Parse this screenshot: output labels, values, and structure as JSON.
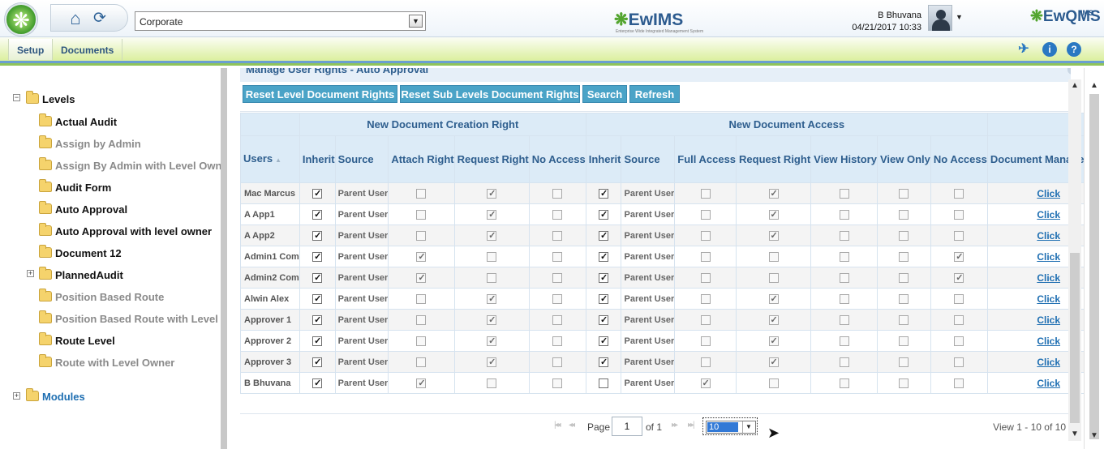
{
  "header": {
    "company": "Corporate",
    "center_logo": "EwIMS",
    "center_logo_tagline": "Enterprise Wide Integrated Management System",
    "user_name": "B Bhuvana",
    "datetime": "04/21/2017 10:33",
    "right_logo": "EwQMS",
    "right_logo_sup": "IMS",
    "home_icon": "home-icon",
    "refresh_icon": "refresh-icon"
  },
  "menu": {
    "setup": "Setup",
    "documents": "Documents",
    "icons": [
      "pin-icon",
      "info-icon",
      "help-icon"
    ]
  },
  "tree": {
    "levels_label": "Levels",
    "levels_expander": "−",
    "modules_label": "Modules",
    "modules_expander": "+",
    "children": [
      {
        "label": "Actual Audit",
        "style": "bold"
      },
      {
        "label": "Assign by Admin",
        "style": "grey"
      },
      {
        "label": "Assign By Admin with Level Owner",
        "style": "grey"
      },
      {
        "label": "Audit Form",
        "style": "bold"
      },
      {
        "label": "Auto Approval",
        "style": "bold"
      },
      {
        "label": "Auto Approval with level owner",
        "style": "bold"
      },
      {
        "label": "Document 12",
        "style": "bold"
      },
      {
        "label": "PlannedAudit",
        "style": "bold",
        "expander": "+"
      },
      {
        "label": "Position Based Route",
        "style": "grey"
      },
      {
        "label": "Position Based Route with Level Owner",
        "style": "grey"
      },
      {
        "label": "Route Level",
        "style": "bold"
      },
      {
        "label": "Route with Level Owner",
        "style": "grey"
      }
    ]
  },
  "section_title": "Manage User Rights - Auto Approval",
  "actions": {
    "reset_level": "Reset Level Document Rights",
    "reset_sub": "Reset Sub Levels Document Rights",
    "search": "Search",
    "refresh": "Refresh"
  },
  "grid": {
    "group_creation": "New Document Creation Right",
    "group_access": "New Document Access",
    "columns": {
      "users": "Users",
      "inherit": "Inherit",
      "source": "Source",
      "attach_right": "Attach Right",
      "request_right": "Request Right",
      "no_access": "No Access",
      "inherit2": "Inherit",
      "source2": "Source",
      "full_access": "Full Access",
      "request_right2": "Request Right",
      "view_history": "View History",
      "view_only": "View Only",
      "no_access2": "No Access",
      "doc_mgmt": "Document Management"
    },
    "link_text": "Click",
    "rows": [
      {
        "user": "Mac Marcus",
        "inherit": true,
        "source": "Parent User",
        "attach": false,
        "request": true,
        "noacc": false,
        "inherit2": true,
        "source2": "Parent User",
        "full": false,
        "request2": true,
        "history": false,
        "viewonly": false,
        "noacc2": false
      },
      {
        "user": "A App1",
        "inherit": true,
        "source": "Parent User",
        "attach": false,
        "request": true,
        "noacc": false,
        "inherit2": true,
        "source2": "Parent User",
        "full": false,
        "request2": true,
        "history": false,
        "viewonly": false,
        "noacc2": false
      },
      {
        "user": "A App2",
        "inherit": true,
        "source": "Parent User",
        "attach": false,
        "request": true,
        "noacc": false,
        "inherit2": true,
        "source2": "Parent User",
        "full": false,
        "request2": true,
        "history": false,
        "viewonly": false,
        "noacc2": false
      },
      {
        "user": "Admin1 Com",
        "inherit": true,
        "source": "Parent User",
        "attach": true,
        "request": false,
        "noacc": false,
        "inherit2": true,
        "source2": "Parent User",
        "full": false,
        "request2": false,
        "history": false,
        "viewonly": false,
        "noacc2": true
      },
      {
        "user": "Admin2 Com",
        "inherit": true,
        "source": "Parent User",
        "attach": true,
        "request": false,
        "noacc": false,
        "inherit2": true,
        "source2": "Parent User",
        "full": false,
        "request2": false,
        "history": false,
        "viewonly": false,
        "noacc2": true
      },
      {
        "user": "Alwin Alex",
        "inherit": true,
        "source": "Parent User",
        "attach": false,
        "request": true,
        "noacc": false,
        "inherit2": true,
        "source2": "Parent User",
        "full": false,
        "request2": true,
        "history": false,
        "viewonly": false,
        "noacc2": false
      },
      {
        "user": "Approver 1",
        "inherit": true,
        "source": "Parent User",
        "attach": false,
        "request": true,
        "noacc": false,
        "inherit2": true,
        "source2": "Parent User",
        "full": false,
        "request2": true,
        "history": false,
        "viewonly": false,
        "noacc2": false
      },
      {
        "user": "Approver 2",
        "inherit": true,
        "source": "Parent User",
        "attach": false,
        "request": true,
        "noacc": false,
        "inherit2": true,
        "source2": "Parent User",
        "full": false,
        "request2": true,
        "history": false,
        "viewonly": false,
        "noacc2": false
      },
      {
        "user": "Approver 3",
        "inherit": true,
        "source": "Parent User",
        "attach": false,
        "request": true,
        "noacc": false,
        "inherit2": true,
        "source2": "Parent User",
        "full": false,
        "request2": true,
        "history": false,
        "viewonly": false,
        "noacc2": false
      },
      {
        "user": "B Bhuvana",
        "inherit": true,
        "source": "Parent User",
        "attach": true,
        "request": false,
        "noacc": false,
        "inherit2": false,
        "source2": "Parent User",
        "full": true,
        "request2": false,
        "history": false,
        "viewonly": false,
        "noacc2": false
      }
    ]
  },
  "pager": {
    "page_label": "Page",
    "page_value": "1",
    "of_label": "of 1",
    "page_size": "10",
    "info": "View 1 - 10 of 10"
  }
}
